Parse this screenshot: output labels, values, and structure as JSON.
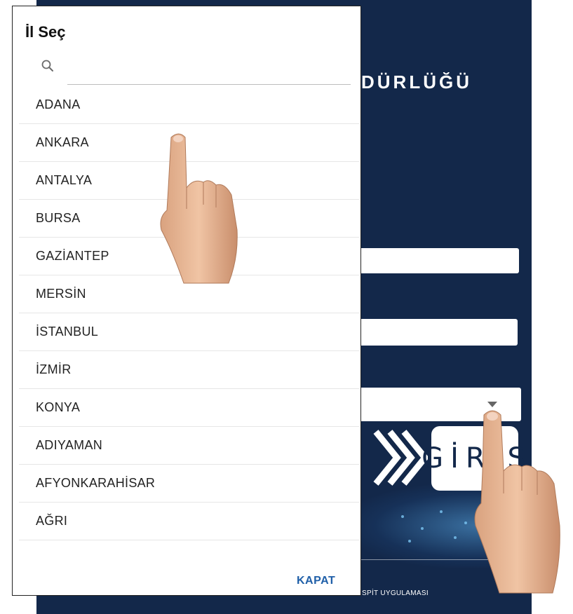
{
  "background": {
    "title_fragment": "DÜRLÜĞÜ",
    "login_button": "GİRİŞ",
    "footer_text_fragment": "SPİT UYGULAMASI",
    "colors": {
      "navy": "#13284a",
      "link_blue": "#1f5fa8"
    }
  },
  "dialog": {
    "title": "İl Seç",
    "search": {
      "value": "",
      "placeholder": ""
    },
    "items": [
      "ADANA",
      "ANKARA",
      "ANTALYA",
      "BURSA",
      "GAZİANTEP",
      "MERSİN",
      "İSTANBUL",
      "İZMİR",
      "KONYA",
      "ADIYAMAN",
      "AFYONKARAHİSAR",
      "AĞRI"
    ],
    "close_label": "KAPAT"
  },
  "icons": [
    "search-icon",
    "chevron-icon",
    "dropdown-arrow-icon",
    "pointing-hand-icon"
  ]
}
